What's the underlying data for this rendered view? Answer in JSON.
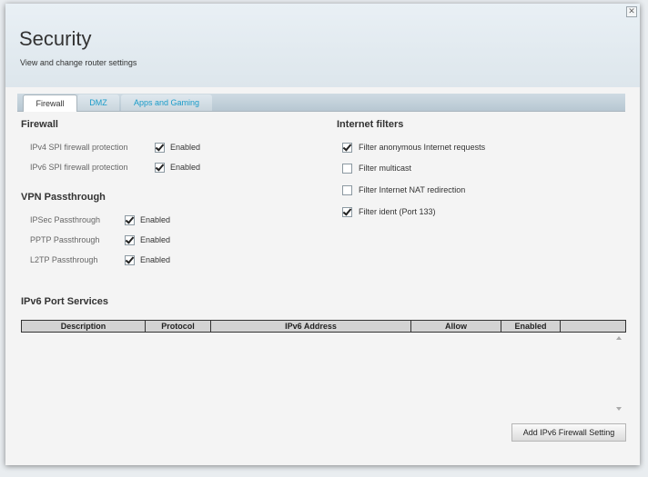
{
  "header": {
    "title": "Security",
    "subtitle": "View and change router settings",
    "close_label": "✕"
  },
  "tabs": [
    {
      "label": "Firewall",
      "active": true
    },
    {
      "label": "DMZ",
      "active": false
    },
    {
      "label": "Apps and Gaming",
      "active": false
    }
  ],
  "firewall": {
    "title": "Firewall",
    "rows": [
      {
        "label": "IPv4 SPI firewall protection",
        "checkbox_label": "Enabled",
        "checked": true
      },
      {
        "label": "IPv6 SPI firewall protection",
        "checkbox_label": "Enabled",
        "checked": true
      }
    ]
  },
  "vpn": {
    "title": "VPN Passthrough",
    "rows": [
      {
        "label": "IPSec Passthrough",
        "checkbox_label": "Enabled",
        "checked": true
      },
      {
        "label": "PPTP Passthrough",
        "checkbox_label": "Enabled",
        "checked": true
      },
      {
        "label": "L2TP Passthrough",
        "checkbox_label": "Enabled",
        "checked": true
      }
    ]
  },
  "internet_filters": {
    "title": "Internet filters",
    "items": [
      {
        "label": "Filter anonymous Internet requests",
        "checked": true
      },
      {
        "label": "Filter multicast",
        "checked": false
      },
      {
        "label": "Filter Internet NAT redirection",
        "checked": false
      },
      {
        "label": "Filter ident (Port 133)",
        "checked": true
      }
    ]
  },
  "ipv6_services": {
    "title": "IPv6 Port Services",
    "columns": [
      "Description",
      "Protocol",
      "IPv6 Address",
      "Allow",
      "Enabled",
      ""
    ],
    "rows": [],
    "add_button_label": "Add IPv6 Firewall Setting"
  },
  "colors": {
    "accent": "#1a9cc9",
    "header_bg": "#e3ebf1",
    "tabbar_bg": "#c4d2db"
  }
}
